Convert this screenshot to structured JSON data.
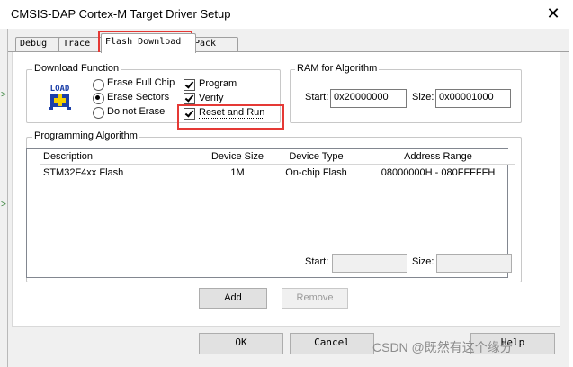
{
  "window": {
    "title": "CMSIS-DAP Cortex-M Target Driver Setup",
    "close_glyph": "✕"
  },
  "tabs": [
    {
      "label": "Debug",
      "active": false
    },
    {
      "label": "Trace",
      "active": false
    },
    {
      "label": "Flash Download",
      "active": true
    },
    {
      "label": "Pack",
      "active": false
    }
  ],
  "download_function": {
    "title": "Download Function",
    "logo_text": "LOAD",
    "radios": [
      {
        "label": "Erase Full Chip",
        "selected": false
      },
      {
        "label": "Erase Sectors",
        "selected": true
      },
      {
        "label": "Do not Erase",
        "selected": false
      }
    ],
    "checkboxes": [
      {
        "label": "Program",
        "checked": true
      },
      {
        "label": "Verify",
        "checked": true
      },
      {
        "label": "Reset and Run",
        "checked": true
      }
    ]
  },
  "ram_for_algorithm": {
    "title": "RAM for Algorithm",
    "start_label": "Start:",
    "start_value": "0x20000000",
    "size_label": "Size:",
    "size_value": "0x00001000"
  },
  "programming_algorithm": {
    "title": "Programming Algorithm",
    "columns": [
      "Description",
      "Device Size",
      "Device Type",
      "Address Range"
    ],
    "rows": [
      [
        "STM32F4xx Flash",
        "1M",
        "On-chip Flash",
        "08000000H - 080FFFFFH"
      ]
    ],
    "start_label": "Start:",
    "start_value": "",
    "size_label": "Size:",
    "size_value": ""
  },
  "buttons": {
    "add": "Add",
    "remove": "Remove",
    "ok": "OK",
    "cancel": "Cancel",
    "help": "Help"
  },
  "watermark": "CSDN @既然有这个缘分",
  "colors": {
    "highlight": "#e53935",
    "dialog_bg": "#f0f0f0",
    "logo_blue": "#1c3fa8",
    "logo_yellow": "#f5d000"
  }
}
